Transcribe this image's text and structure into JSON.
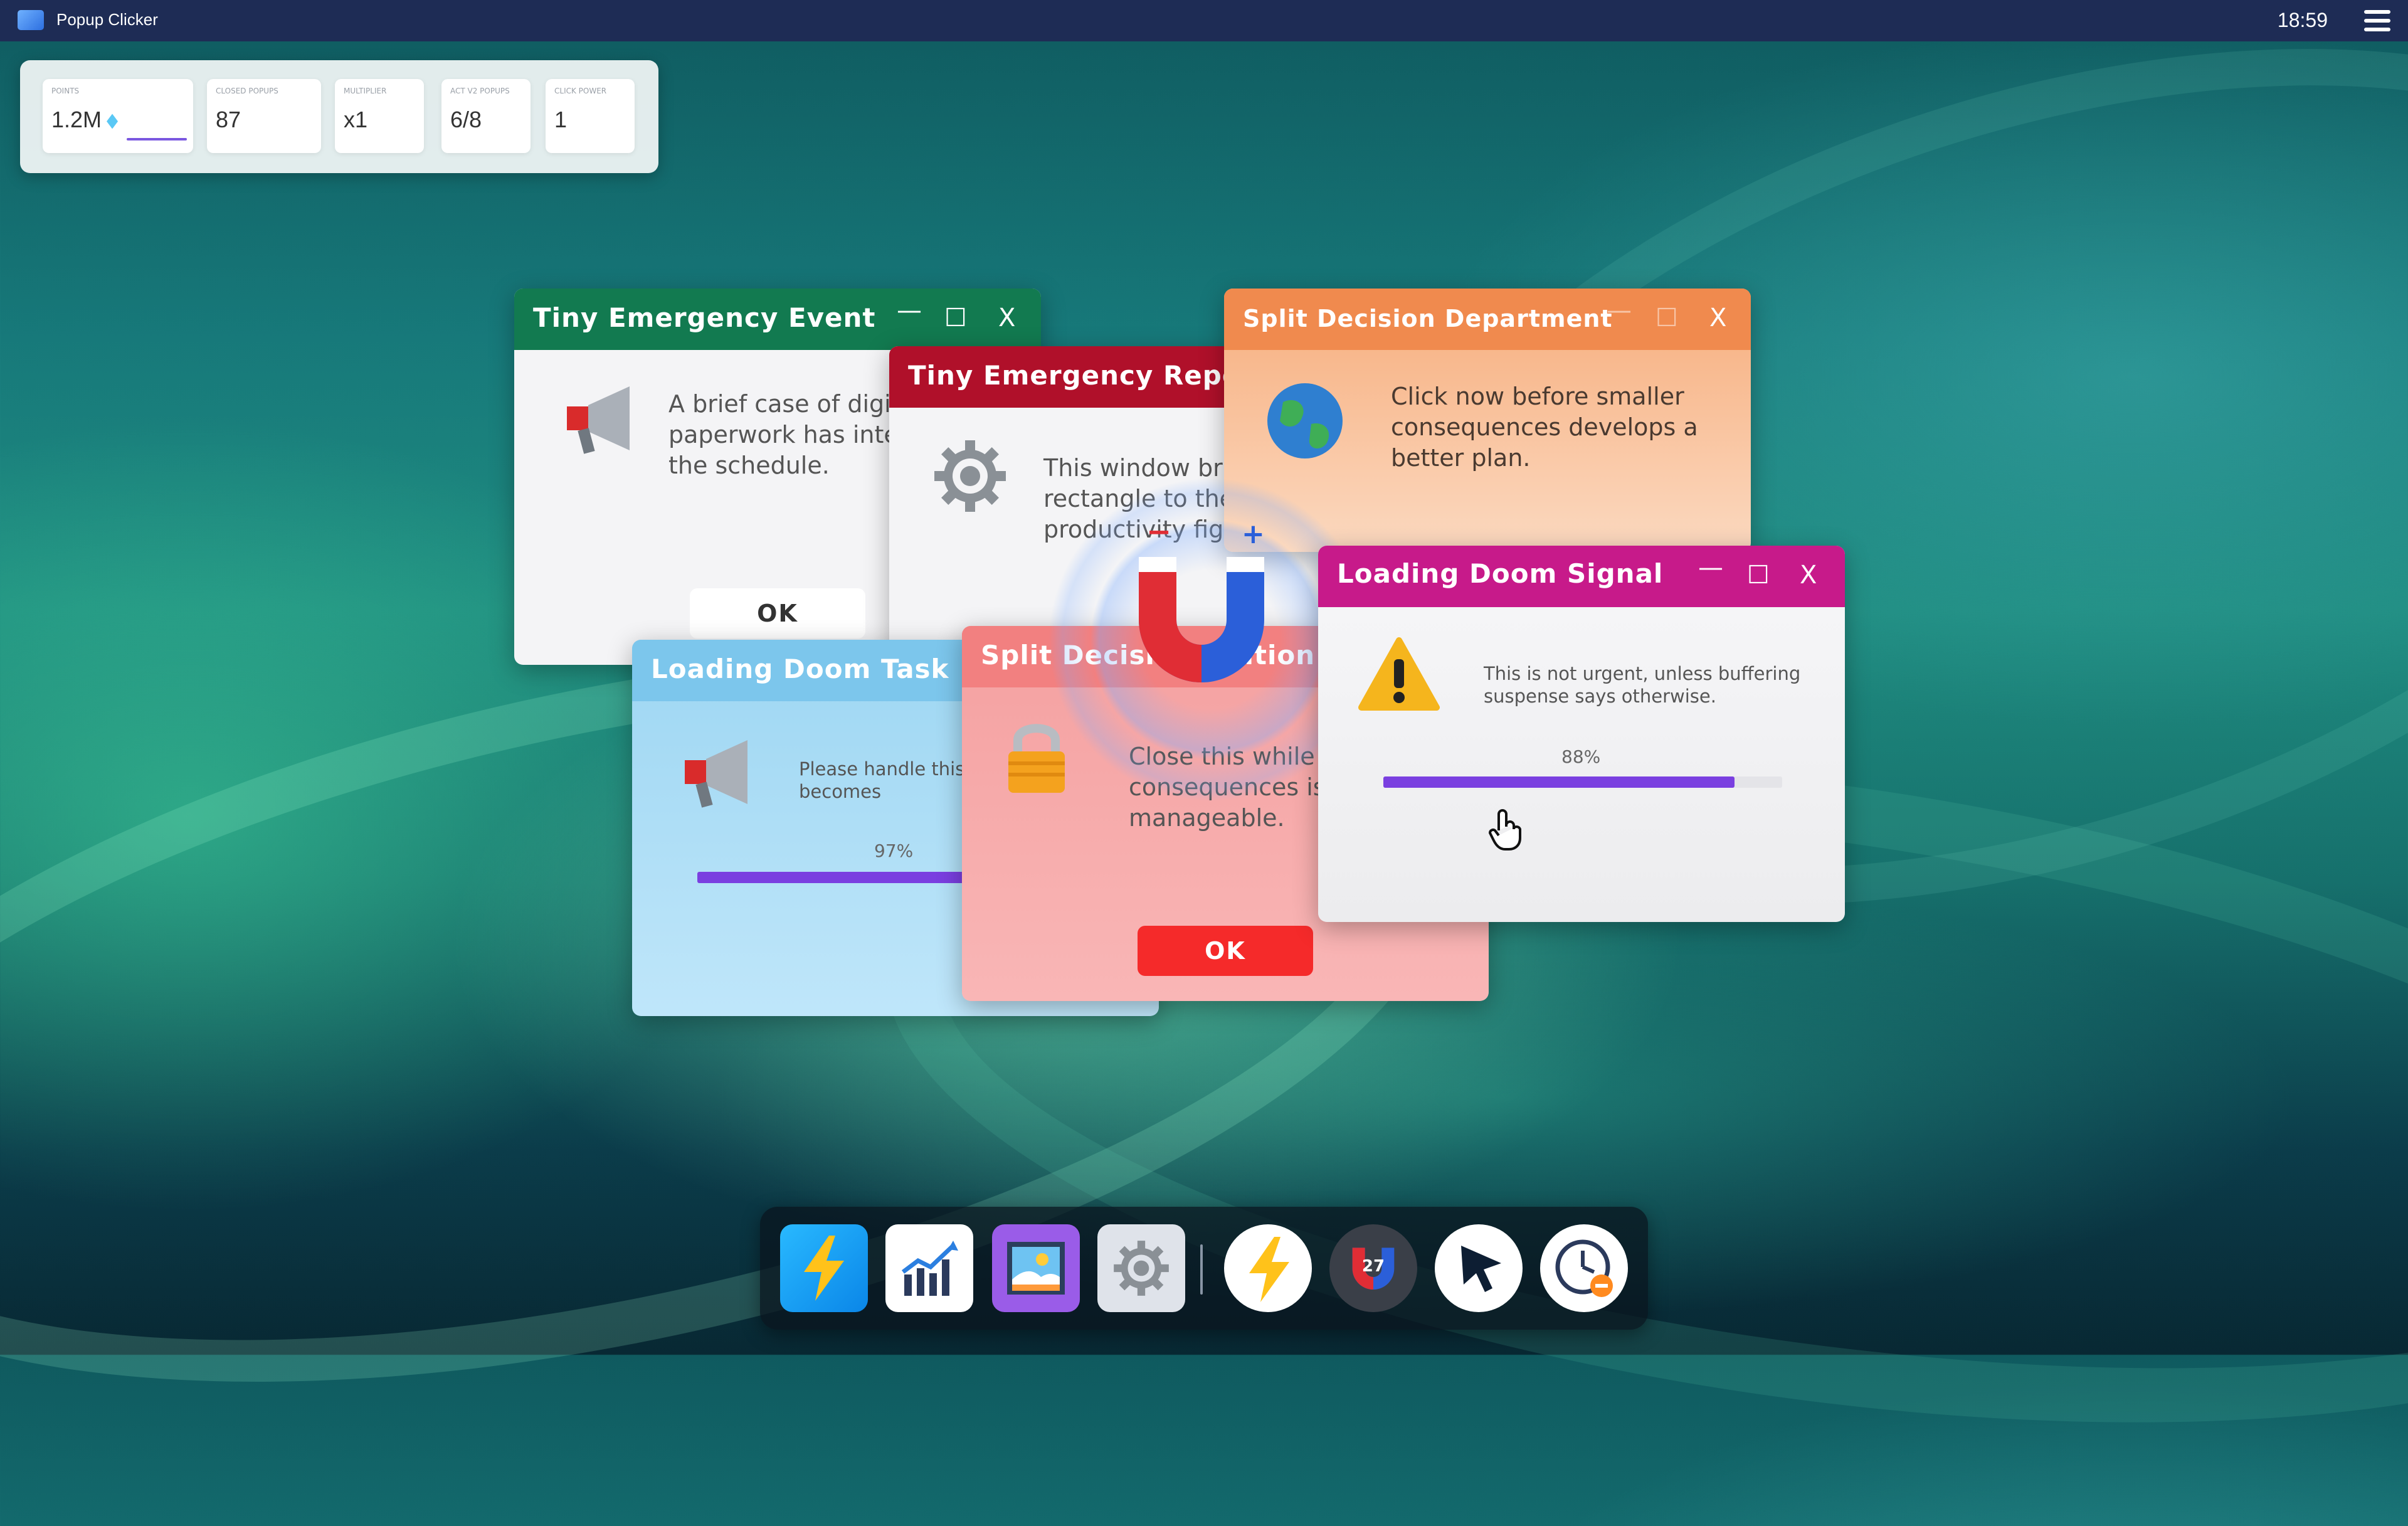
{
  "topbar": {
    "title": "Popup Clicker",
    "time": "18:59",
    "app_icon": "window-icon",
    "menu_icon": "hamburger-menu-icon"
  },
  "stats": [
    {
      "label": "POINTS",
      "value": "1.2M",
      "icon": "diamond-gem-icon"
    },
    {
      "label": "CLOSED POPUPS",
      "value": "87"
    },
    {
      "label": "MULTIPLIER",
      "value": "x1"
    },
    {
      "label": "ACT V2 POPUPS",
      "value": "6/8"
    },
    {
      "label": "CLICK POWER",
      "value": "1"
    }
  ],
  "window_controls": {
    "minimize": "—",
    "maximize": "☐",
    "close": "X"
  },
  "popups": {
    "tiny_emergency_event": {
      "title": "Tiny Emergency Event",
      "message": "A brief case of digital paperwork has interrupted the schedule.",
      "ok": "OK",
      "icon": "megaphone-icon",
      "color": "#127a50"
    },
    "tiny_emergency_report": {
      "title": "Tiny Emergency Report",
      "message": "This window brings a needy rectangle to the productivity fight.",
      "icon": "gear-icon",
      "color": "#b0102a"
    },
    "split_decision_department": {
      "title": "Split Decision Department",
      "message": "Click now before smaller consequences develops a better plan.",
      "icon": "globe-icon",
      "color": "#f08a4e"
    },
    "loading_doom_task": {
      "title": "Loading Doom Task",
      "message": "Please handle this before suspense becomes",
      "progress_label": "97%",
      "progress": 0.97,
      "icon": "megaphone-icon",
      "color": "#7cc6ec"
    },
    "split_decision_station": {
      "title": "Split Decision Station",
      "message": "Close this while consequences is manageable.",
      "ok": "OK",
      "icon": "lock-icon",
      "color": "#f28080"
    },
    "loading_doom_signal": {
      "title": "Loading Doom Signal",
      "message": "This is not urgent, unless buffering suspense says otherwise.",
      "progress_label": "88%",
      "progress": 0.88,
      "icon": "warning-icon",
      "color": "#c71a8a"
    }
  },
  "magnet": {
    "icon": "magnet-icon",
    "minus": "−",
    "plus": "+"
  },
  "dock": [
    {
      "name": "lightning-app-icon"
    },
    {
      "name": "chart-app-icon"
    },
    {
      "name": "gallery-app-icon"
    },
    {
      "name": "settings-app-icon"
    },
    {
      "name": "lightning-powerup-icon"
    },
    {
      "name": "magnet-powerup-icon",
      "badge": "27"
    },
    {
      "name": "cursor-powerup-icon"
    },
    {
      "name": "timer-powerup-icon"
    }
  ]
}
